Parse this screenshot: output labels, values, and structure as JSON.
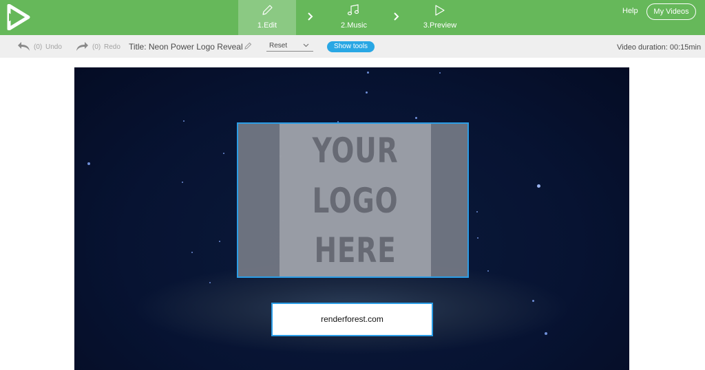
{
  "topbar": {
    "steps": [
      {
        "label": "1.Edit",
        "icon": "pencil-icon"
      },
      {
        "label": "2.Music",
        "icon": "music-note-icon"
      },
      {
        "label": "3.Preview",
        "icon": "play-icon"
      }
    ],
    "help": "Help",
    "my_videos": "My Videos",
    "accent": "#66b85a",
    "active_step_bg": "#8bc983"
  },
  "toolbar": {
    "undo_count": "(0)",
    "undo": "Undo",
    "redo_count": "(0)",
    "redo": "Redo",
    "title": "Title: Neon Power Logo Reveal",
    "reset": "Reset",
    "show_tools": "Show tools",
    "duration": "Video duration: 00:15min",
    "button_color": "#29a7e4"
  },
  "preview": {
    "logo_lines": [
      "YOUR",
      "LOGO",
      "HERE"
    ],
    "url": "renderforest.com",
    "selection_color": "#2b9de6"
  }
}
